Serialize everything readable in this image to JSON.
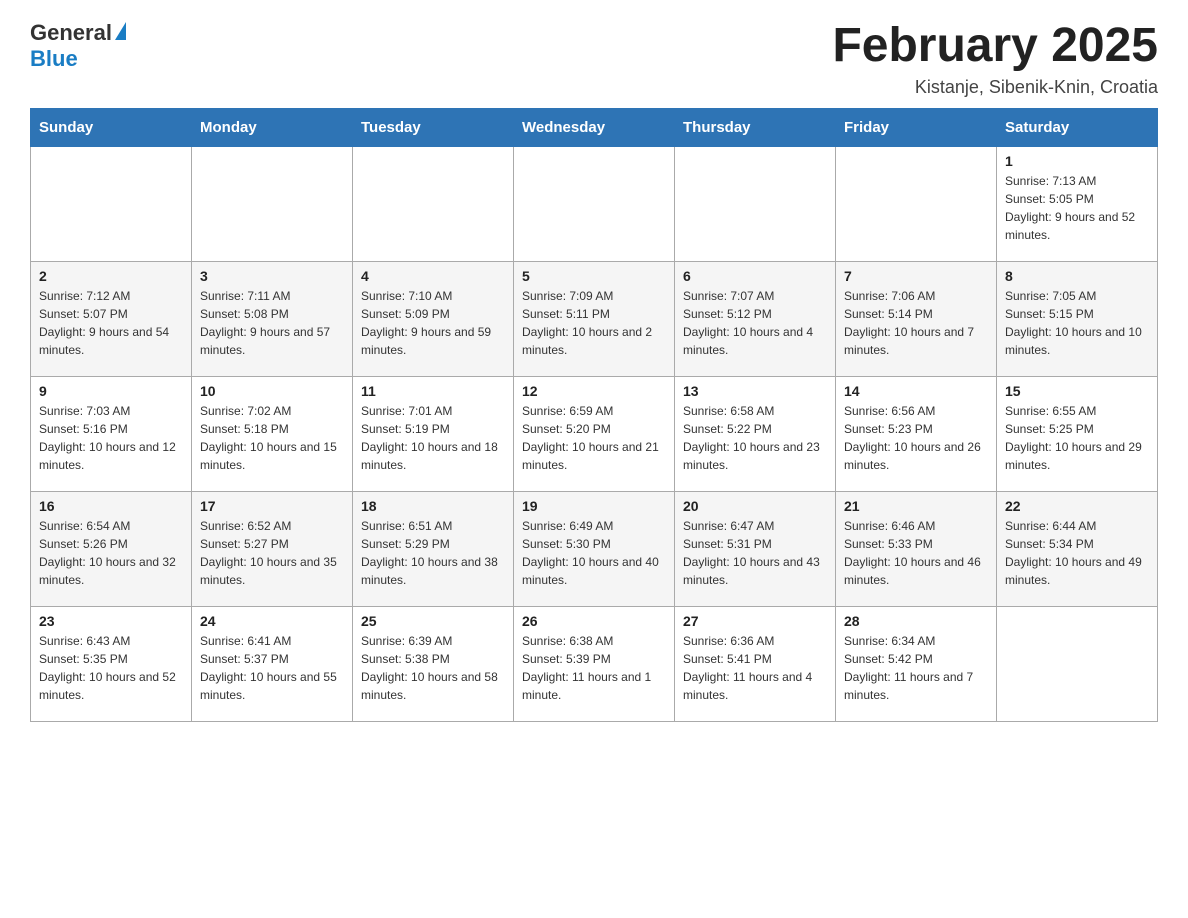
{
  "header": {
    "logo": {
      "text_general": "General",
      "text_blue": "Blue"
    },
    "title": "February 2025",
    "location": "Kistanje, Sibenik-Knin, Croatia"
  },
  "calendar": {
    "days_of_week": [
      "Sunday",
      "Monday",
      "Tuesday",
      "Wednesday",
      "Thursday",
      "Friday",
      "Saturday"
    ],
    "weeks": [
      [
        {
          "day": "",
          "info": ""
        },
        {
          "day": "",
          "info": ""
        },
        {
          "day": "",
          "info": ""
        },
        {
          "day": "",
          "info": ""
        },
        {
          "day": "",
          "info": ""
        },
        {
          "day": "",
          "info": ""
        },
        {
          "day": "1",
          "info": "Sunrise: 7:13 AM\nSunset: 5:05 PM\nDaylight: 9 hours and 52 minutes."
        }
      ],
      [
        {
          "day": "2",
          "info": "Sunrise: 7:12 AM\nSunset: 5:07 PM\nDaylight: 9 hours and 54 minutes."
        },
        {
          "day": "3",
          "info": "Sunrise: 7:11 AM\nSunset: 5:08 PM\nDaylight: 9 hours and 57 minutes."
        },
        {
          "day": "4",
          "info": "Sunrise: 7:10 AM\nSunset: 5:09 PM\nDaylight: 9 hours and 59 minutes."
        },
        {
          "day": "5",
          "info": "Sunrise: 7:09 AM\nSunset: 5:11 PM\nDaylight: 10 hours and 2 minutes."
        },
        {
          "day": "6",
          "info": "Sunrise: 7:07 AM\nSunset: 5:12 PM\nDaylight: 10 hours and 4 minutes."
        },
        {
          "day": "7",
          "info": "Sunrise: 7:06 AM\nSunset: 5:14 PM\nDaylight: 10 hours and 7 minutes."
        },
        {
          "day": "8",
          "info": "Sunrise: 7:05 AM\nSunset: 5:15 PM\nDaylight: 10 hours and 10 minutes."
        }
      ],
      [
        {
          "day": "9",
          "info": "Sunrise: 7:03 AM\nSunset: 5:16 PM\nDaylight: 10 hours and 12 minutes."
        },
        {
          "day": "10",
          "info": "Sunrise: 7:02 AM\nSunset: 5:18 PM\nDaylight: 10 hours and 15 minutes."
        },
        {
          "day": "11",
          "info": "Sunrise: 7:01 AM\nSunset: 5:19 PM\nDaylight: 10 hours and 18 minutes."
        },
        {
          "day": "12",
          "info": "Sunrise: 6:59 AM\nSunset: 5:20 PM\nDaylight: 10 hours and 21 minutes."
        },
        {
          "day": "13",
          "info": "Sunrise: 6:58 AM\nSunset: 5:22 PM\nDaylight: 10 hours and 23 minutes."
        },
        {
          "day": "14",
          "info": "Sunrise: 6:56 AM\nSunset: 5:23 PM\nDaylight: 10 hours and 26 minutes."
        },
        {
          "day": "15",
          "info": "Sunrise: 6:55 AM\nSunset: 5:25 PM\nDaylight: 10 hours and 29 minutes."
        }
      ],
      [
        {
          "day": "16",
          "info": "Sunrise: 6:54 AM\nSunset: 5:26 PM\nDaylight: 10 hours and 32 minutes."
        },
        {
          "day": "17",
          "info": "Sunrise: 6:52 AM\nSunset: 5:27 PM\nDaylight: 10 hours and 35 minutes."
        },
        {
          "day": "18",
          "info": "Sunrise: 6:51 AM\nSunset: 5:29 PM\nDaylight: 10 hours and 38 minutes."
        },
        {
          "day": "19",
          "info": "Sunrise: 6:49 AM\nSunset: 5:30 PM\nDaylight: 10 hours and 40 minutes."
        },
        {
          "day": "20",
          "info": "Sunrise: 6:47 AM\nSunset: 5:31 PM\nDaylight: 10 hours and 43 minutes."
        },
        {
          "day": "21",
          "info": "Sunrise: 6:46 AM\nSunset: 5:33 PM\nDaylight: 10 hours and 46 minutes."
        },
        {
          "day": "22",
          "info": "Sunrise: 6:44 AM\nSunset: 5:34 PM\nDaylight: 10 hours and 49 minutes."
        }
      ],
      [
        {
          "day": "23",
          "info": "Sunrise: 6:43 AM\nSunset: 5:35 PM\nDaylight: 10 hours and 52 minutes."
        },
        {
          "day": "24",
          "info": "Sunrise: 6:41 AM\nSunset: 5:37 PM\nDaylight: 10 hours and 55 minutes."
        },
        {
          "day": "25",
          "info": "Sunrise: 6:39 AM\nSunset: 5:38 PM\nDaylight: 10 hours and 58 minutes."
        },
        {
          "day": "26",
          "info": "Sunrise: 6:38 AM\nSunset: 5:39 PM\nDaylight: 11 hours and 1 minute."
        },
        {
          "day": "27",
          "info": "Sunrise: 6:36 AM\nSunset: 5:41 PM\nDaylight: 11 hours and 4 minutes."
        },
        {
          "day": "28",
          "info": "Sunrise: 6:34 AM\nSunset: 5:42 PM\nDaylight: 11 hours and 7 minutes."
        },
        {
          "day": "",
          "info": ""
        }
      ]
    ]
  }
}
